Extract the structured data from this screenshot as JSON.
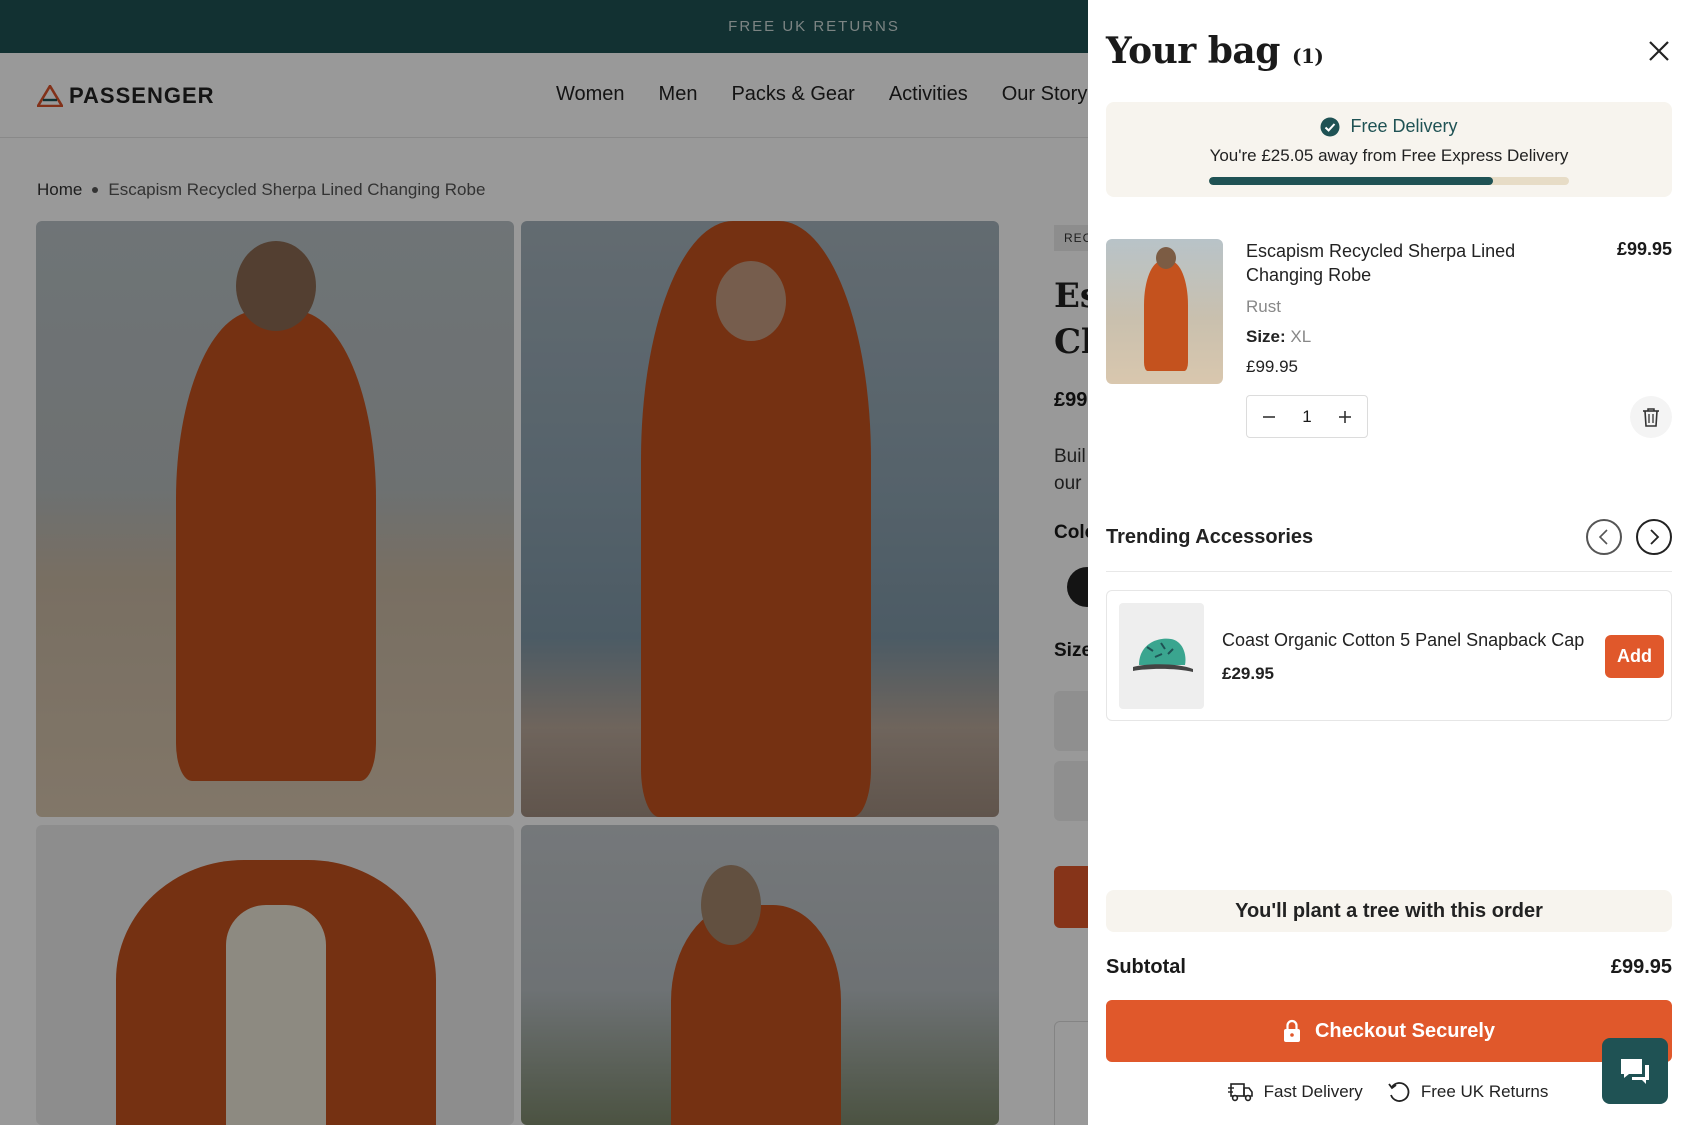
{
  "announcement": {
    "text": "FREE UK RETURNS"
  },
  "brand": {
    "name": "PASSENGER"
  },
  "nav": [
    "Women",
    "Men",
    "Packs & Gear",
    "Activities",
    "Our Story"
  ],
  "breadcrumb": {
    "home": "Home",
    "current": "Escapism Recycled Sherpa Lined Changing Robe"
  },
  "product_peek": {
    "tag": "REC",
    "title": "Es\nCh",
    "price": "£99",
    "desc": "Buil\nour",
    "colour": "Colo",
    "size": "Size"
  },
  "drawer": {
    "title": "Your bag",
    "count": "(1)",
    "delivery": {
      "heading": "Free Delivery",
      "message": "You're £25.05 away from Free Express Delivery",
      "progress_percent": 79
    },
    "item": {
      "name": "Escapism Recycled Sherpa Lined Changing Robe",
      "line_price": "£99.95",
      "colour": "Rust",
      "size_label": "Size:",
      "size_value": "XL",
      "unit_price": "£99.95",
      "quantity": "1"
    },
    "trending": {
      "heading": "Trending Accessories",
      "product": {
        "name": "Coast Organic Cotton 5 Panel Snapback Cap",
        "price": "£29.95",
        "add_label": "Add"
      }
    },
    "tree_message": "You'll plant a tree with this order",
    "subtotal_label": "Subtotal",
    "subtotal_value": "£99.95",
    "checkout_label": "Checkout Securely",
    "features": [
      "Fast Delivery",
      "Free UK Returns"
    ]
  },
  "colors": {
    "accent": "#e0582b",
    "brand_teal": "#1f5254",
    "cream": "#f7f4ee"
  }
}
